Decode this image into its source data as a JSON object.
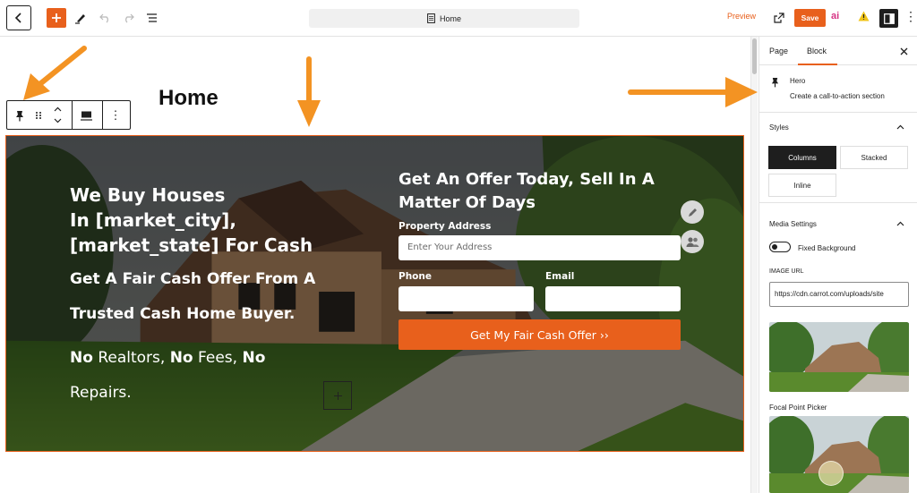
{
  "topbar": {
    "document_title": "Home",
    "preview_label": "Preview",
    "save_label": "Save",
    "ai_label": "ai"
  },
  "canvas": {
    "page_title": "Home"
  },
  "hero": {
    "heading_line1": "We Buy Houses",
    "heading_line2": "In [market_city],",
    "heading_line3": "[market_state] For Cash",
    "subheading_line1": "Get A Fair Cash Offer From A",
    "subheading_line2": "Trusted Cash Home Buyer.",
    "no_1": "No",
    "realtors": " Realtors, ",
    "no_2": "No",
    "fees": " Fees, ",
    "no_3": "No",
    "repairs": "Repairs.",
    "form_heading_line1": "Get An Offer Today, Sell In A",
    "form_heading_line2": "Matter Of Days",
    "address_label": "Property Address",
    "address_placeholder": "Enter Your Address",
    "phone_label": "Phone",
    "email_label": "Email",
    "cta_label": "Get My Fair Cash Offer ››"
  },
  "sidebar": {
    "tab_page": "Page",
    "tab_block": "Block",
    "block_name": "Hero",
    "block_description": "Create a call-to-action section",
    "styles_heading": "Styles",
    "style_columns": "Columns",
    "style_stacked": "Stacked",
    "style_inline": "Inline",
    "media_heading": "Media Settings",
    "fixed_background_label": "Fixed Background",
    "fixed_background_enabled": false,
    "image_url_label": "IMAGE URL",
    "image_url_value": "https://cdn.carrot.com/uploads/site",
    "focal_point_label": "Focal Point Picker"
  },
  "colors": {
    "accent": "#e8601c",
    "dark": "#1e1e1e",
    "annotation_arrow": "#f39323"
  }
}
